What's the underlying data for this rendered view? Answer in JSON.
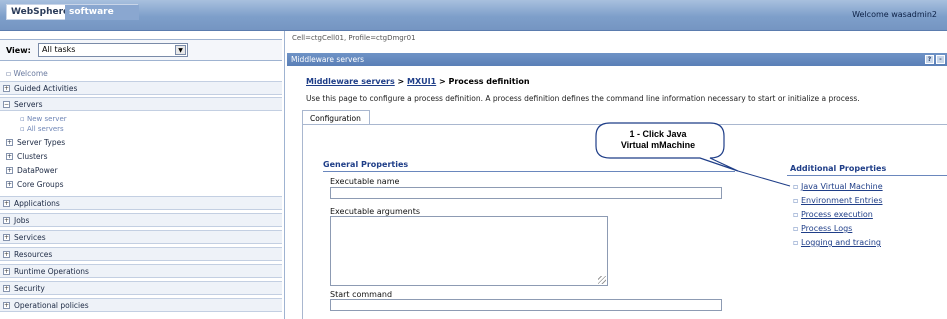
{
  "banner": {
    "logo_primary": "WebSphere.",
    "logo_secondary": "software",
    "welcome": "Welcome wasadmin2"
  },
  "nav": {
    "view_label": "View:",
    "view_value": "All tasks",
    "welcome": "Welcome",
    "groups": [
      {
        "label": "Guided Activities",
        "state": "+"
      },
      {
        "label": "Servers",
        "state": "-"
      },
      {
        "label": "Applications",
        "state": "+"
      },
      {
        "label": "Jobs",
        "state": "+"
      },
      {
        "label": "Services",
        "state": "+"
      },
      {
        "label": "Resources",
        "state": "+"
      },
      {
        "label": "Runtime Operations",
        "state": "+"
      },
      {
        "label": "Security",
        "state": "+"
      },
      {
        "label": "Operational policies",
        "state": "+"
      }
    ],
    "server_links": [
      "New server",
      "All servers"
    ],
    "server_subgroups": [
      "Server Types",
      "Clusters",
      "DataPower",
      "Core Groups"
    ]
  },
  "main": {
    "cell_info": "Cell=ctgCell01, Profile=ctgDmgr01",
    "section_title": "Middleware servers",
    "help_btn": "?",
    "min_btn": "-",
    "breadcrumb": {
      "link1": "Middleware servers",
      "sep": " > ",
      "link2": "MXUI1",
      "current": "Process definition"
    },
    "description": "Use this page to configure a process definition. A process definition defines the command line information necessary to start or initialize a process.",
    "tab": "Configuration",
    "general_properties": "General Properties",
    "fields": {
      "executable_name": "Executable name",
      "executable_arguments": "Executable arguments",
      "start_command": "Start command"
    },
    "additional_properties": {
      "title": "Additional Properties",
      "links": [
        "Java Virtual Machine",
        "Environment Entries",
        "Process execution",
        "Process Logs",
        "Logging and tracing"
      ]
    }
  },
  "callout": {
    "line1": "1 - Click Java",
    "line2": "Virtual mMachine"
  }
}
